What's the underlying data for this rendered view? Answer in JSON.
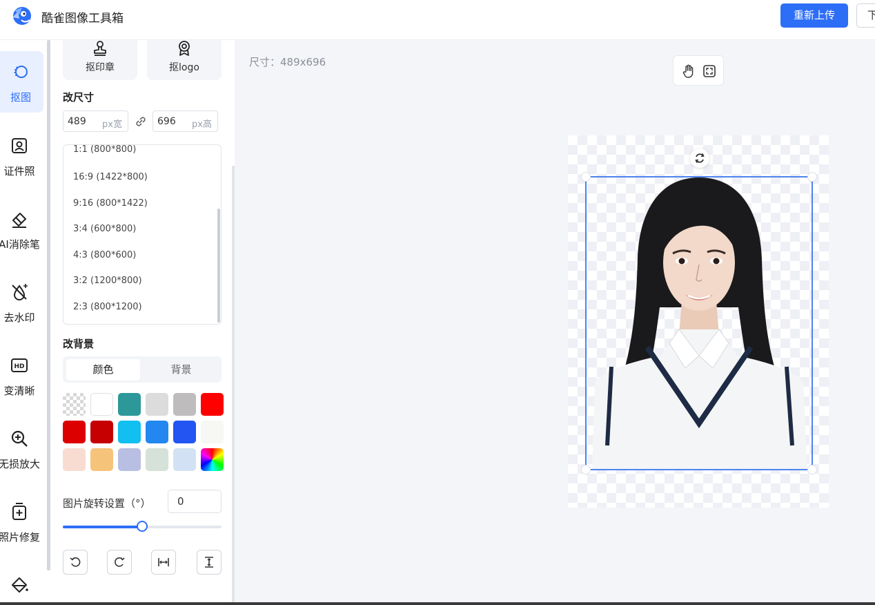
{
  "header": {
    "app_title": "酷雀图像工具箱",
    "reupload_label": "重新上传",
    "download_label": "下"
  },
  "leftnav": {
    "items": [
      {
        "label": "抠图",
        "icon": "cutout-icon",
        "active": true
      },
      {
        "label": "证件照",
        "icon": "id-photo-icon"
      },
      {
        "label": "AI消除笔",
        "icon": "eraser-icon"
      },
      {
        "label": "去水印",
        "icon": "watermark-remove-icon"
      },
      {
        "label": "变清晰",
        "icon": "hd-icon"
      },
      {
        "label": "无损放大",
        "icon": "zoom-in-icon"
      },
      {
        "label": "照片修复",
        "icon": "photo-repair-icon"
      },
      {
        "label": "",
        "icon": "paint-bucket-icon"
      }
    ]
  },
  "panel": {
    "tools": [
      {
        "label": "抠印章",
        "icon": "stamp-icon"
      },
      {
        "label": "抠logo",
        "icon": "badge-icon"
      }
    ],
    "resize": {
      "title": "改尺寸",
      "width_value": "489",
      "width_unit": "px宽",
      "height_value": "696",
      "height_unit": "px高",
      "ratios": [
        "1:1 (800*800)",
        "16:9  (1422*800)",
        "9:16  (800*1422)",
        "3:4  (600*800)",
        "4:3  (800*600)",
        "3:2  (1200*800)",
        "2:3  (800*1200)"
      ]
    },
    "background": {
      "title": "改背景",
      "tabs": [
        "颜色",
        "背景"
      ],
      "active_tab": "颜色",
      "swatches": [
        "transparent",
        "#ffffff",
        "#2c989a",
        "#dcdcdc",
        "#bfbcbd",
        "#fe0000",
        "#dd0000",
        "#c60000",
        "#11bff0",
        "#2288f0",
        "#2255f2",
        "#f7f7f4",
        "#f8dcd2",
        "#f6c37b",
        "#b9bfe2",
        "#d6e1da",
        "#d2e2f4",
        "rainbow"
      ]
    },
    "rotation": {
      "label": "图片旋转设置（°）",
      "value": "0",
      "slider_fraction": 0.5
    },
    "actions": [
      "rotate-left-icon",
      "rotate-right-icon",
      "flip-horizontal-icon",
      "flip-vertical-icon"
    ]
  },
  "canvas": {
    "size_text": "尺寸：489x696",
    "tools": [
      "hand-icon",
      "fullscreen-icon"
    ]
  }
}
